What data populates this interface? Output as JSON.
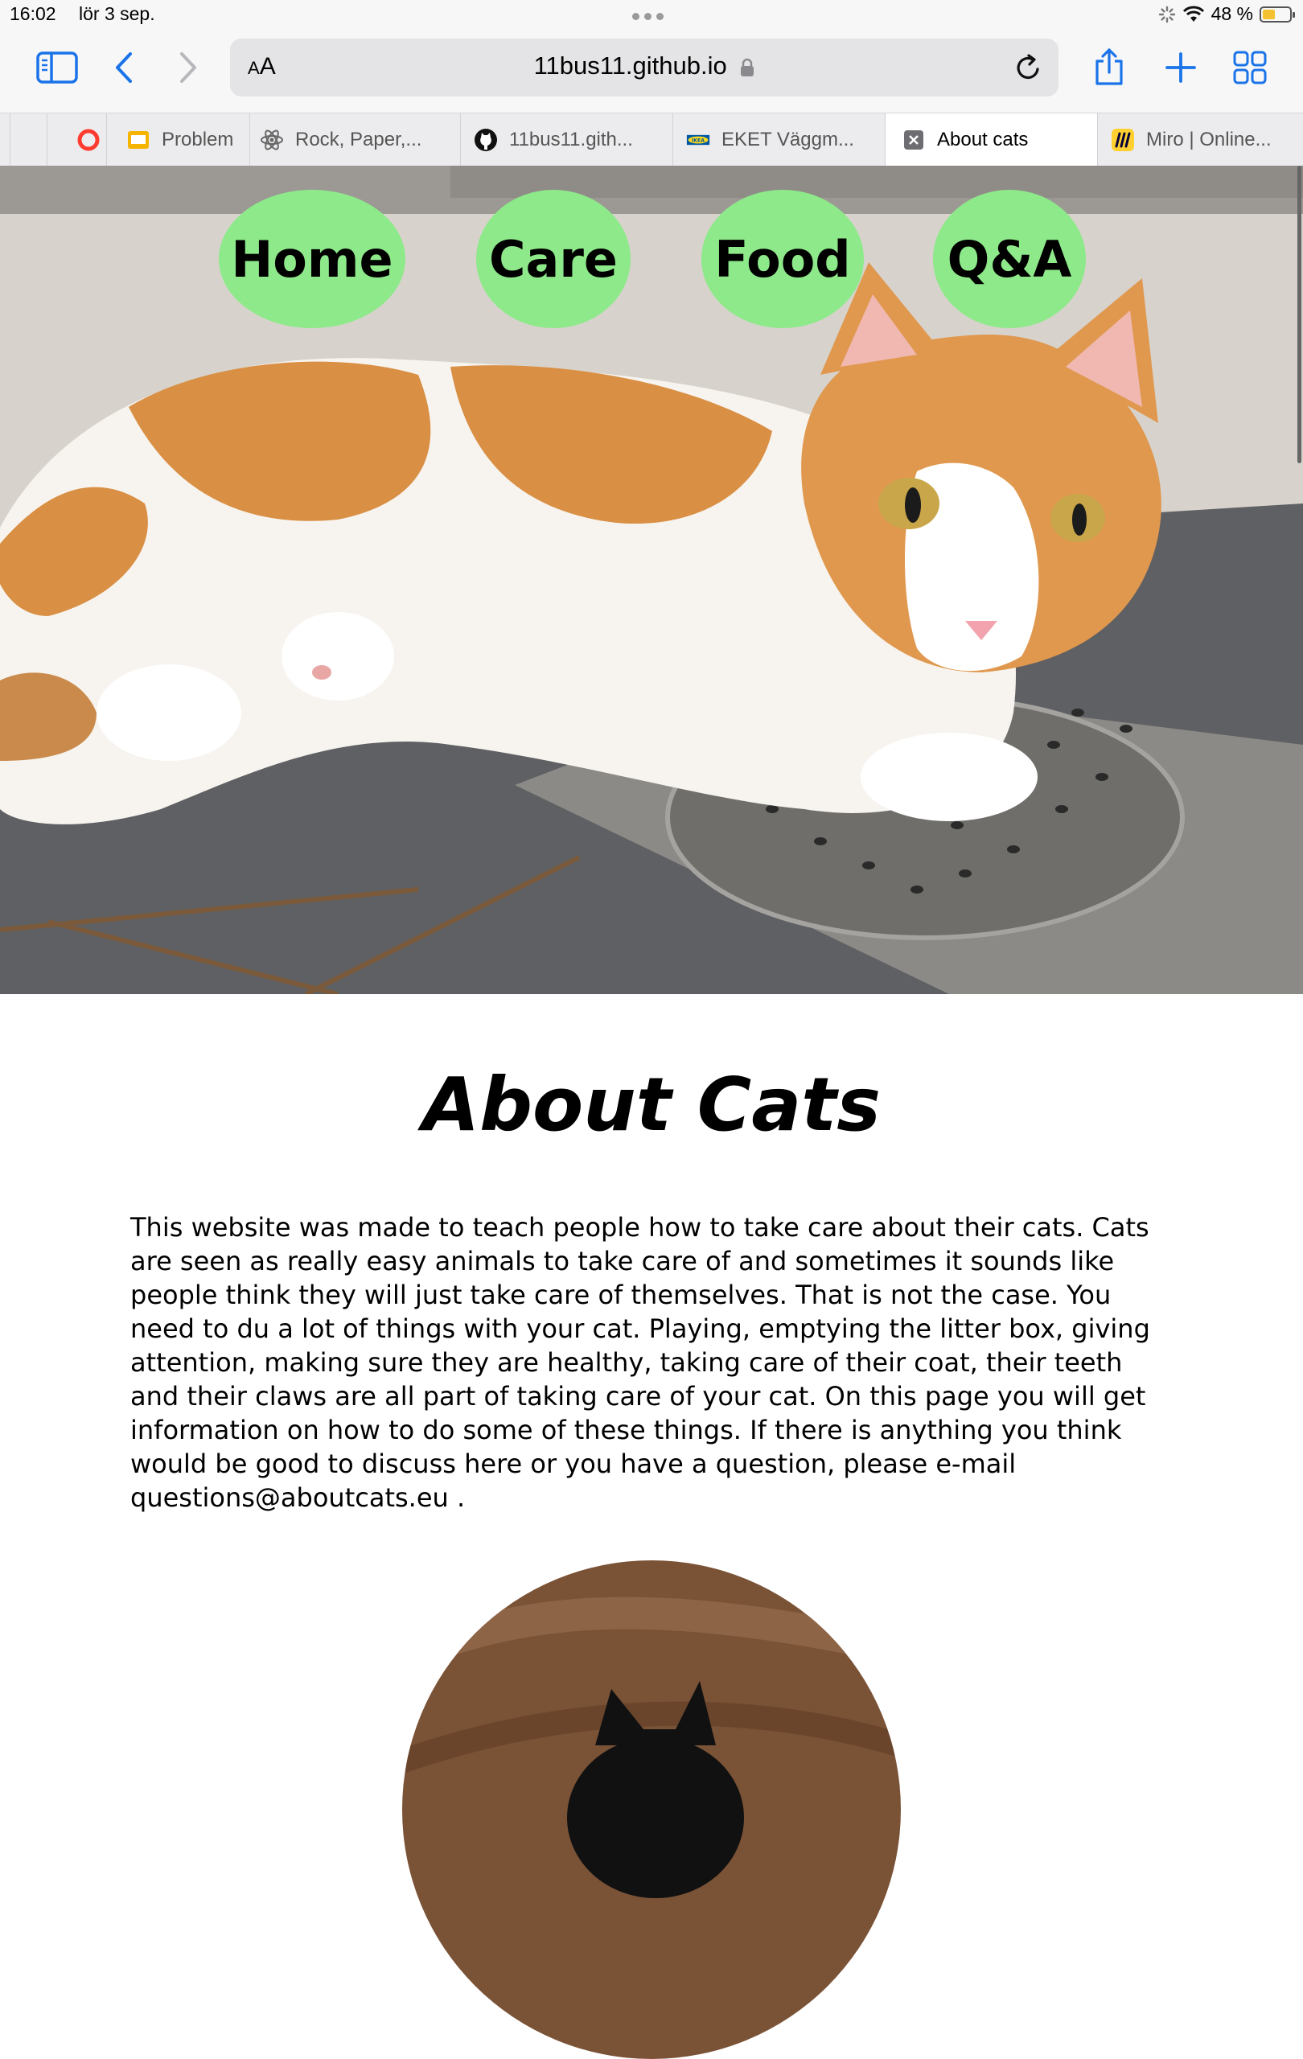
{
  "status_bar": {
    "time": "16:02",
    "date": "lör 3 sep.",
    "battery": "48 %",
    "battery_level": 0.48
  },
  "toolbar": {
    "text_size_label": "AA",
    "url": "11bus11.github.io",
    "accent_color": "#1a73e8"
  },
  "tabs": [
    {
      "label": "",
      "icon": "tab-icon"
    },
    {
      "label": "",
      "icon": "opera-icon"
    },
    {
      "label": "Problem",
      "icon": "slides-icon"
    },
    {
      "label": "Rock, Paper,...",
      "icon": "atom-icon"
    },
    {
      "label": "11bus11.gith...",
      "icon": "github-icon"
    },
    {
      "label": "EKET Väggm...",
      "icon": "ikea-icon"
    },
    {
      "label": "About cats",
      "icon": "close-icon",
      "active": true
    },
    {
      "label": "Miro | Online...",
      "icon": "miro-icon"
    }
  ],
  "nav": {
    "home": "Home",
    "care": "Care",
    "food": "Food",
    "qa": "Q&A",
    "button_color": "#8ee98a"
  },
  "main": {
    "title": "About Cats",
    "intro": "This website was made to teach people how to take care about their cats. Cats are seen as really easy animals to take care of and sometimes it sounds like people think they will just take care of themselves. That is not the case. You need to du a lot of things with your cat. Playing, emptying the litter box, giving attention, making sure they are healthy, taking care of their coat, their teeth and their claws are all part of taking care of your cat. On this page you will get information on how to do some of these things. If there is anything you think would be good to discuss here or you have a question, please e-mail questions@aboutcats.eu ."
  }
}
